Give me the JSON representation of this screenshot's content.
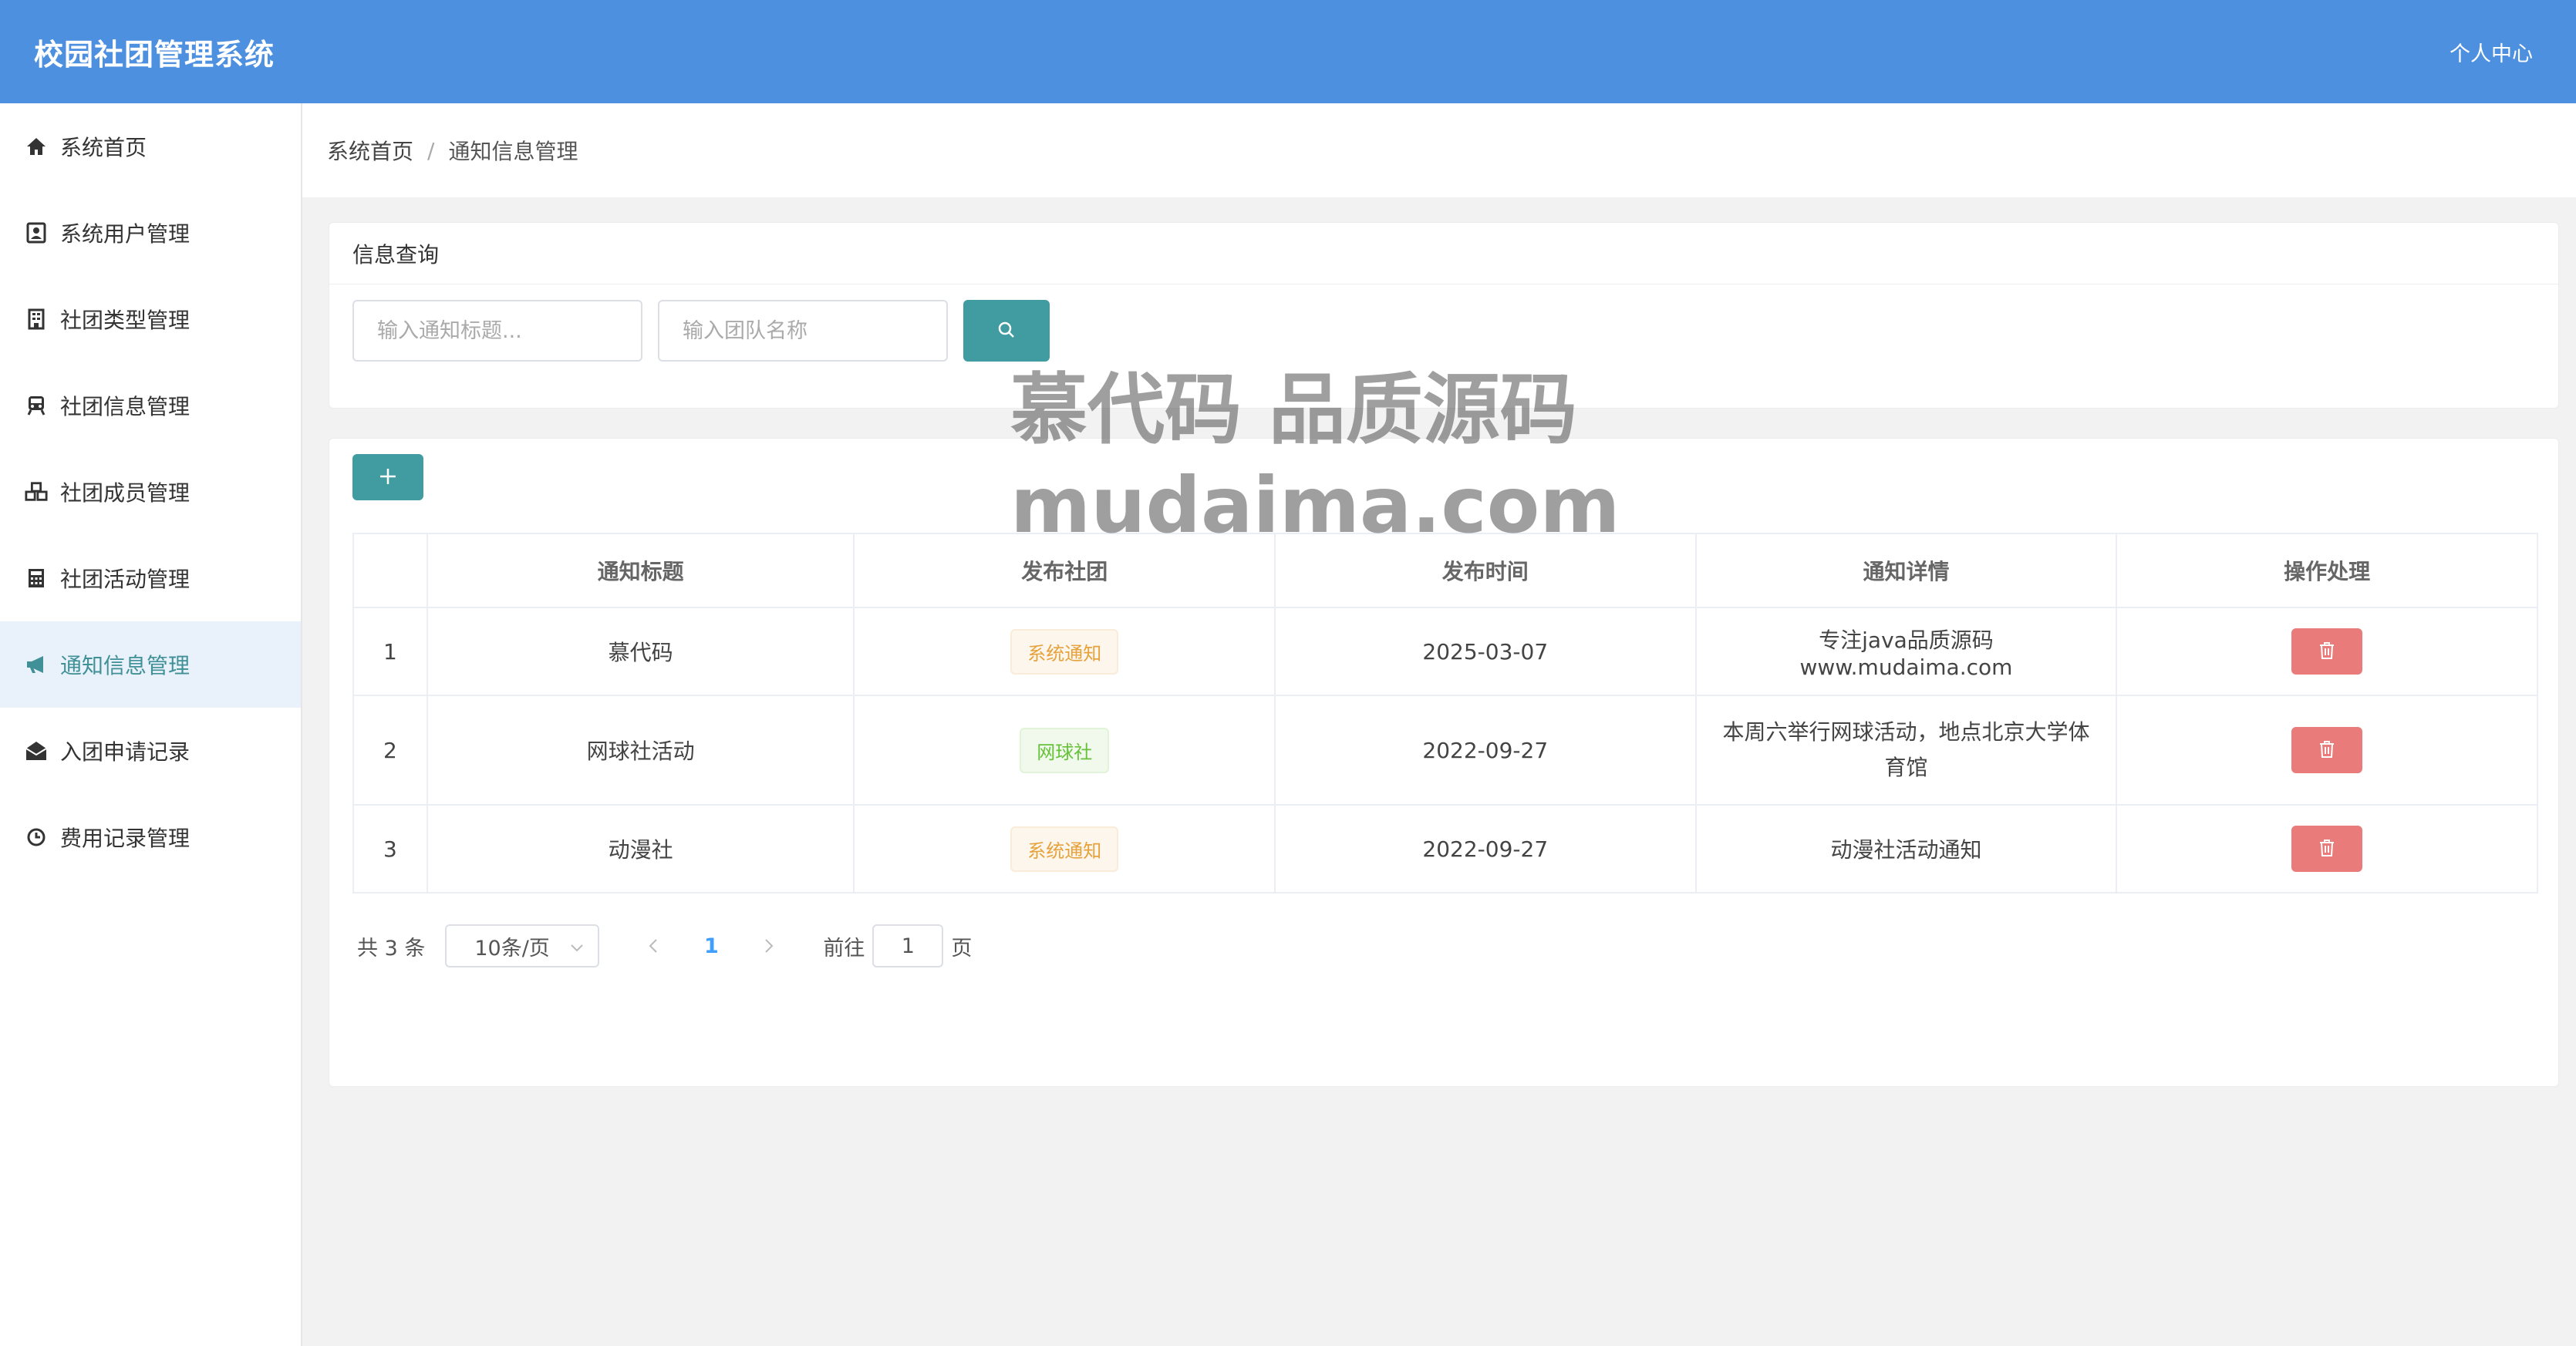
{
  "header": {
    "title": "校园社团管理系统",
    "user": "个人中心"
  },
  "sidebar": {
    "items": [
      {
        "label": "系统首页",
        "icon": "home-icon"
      },
      {
        "label": "系统用户管理",
        "icon": "user-card-icon"
      },
      {
        "label": "社团类型管理",
        "icon": "building-icon"
      },
      {
        "label": "社团信息管理",
        "icon": "train-icon"
      },
      {
        "label": "社团成员管理",
        "icon": "cubes-icon"
      },
      {
        "label": "社团活动管理",
        "icon": "calculator-icon"
      },
      {
        "label": "通知信息管理",
        "icon": "megaphone-icon"
      },
      {
        "label": "入团申请记录",
        "icon": "envelope-open-icon"
      },
      {
        "label": "费用记录管理",
        "icon": "clock-icon"
      }
    ],
    "active_index": 6,
    "active_color": "#409097"
  },
  "breadcrumb": {
    "home": "系统首页",
    "current": "通知信息管理"
  },
  "query": {
    "title": "信息查询",
    "title_placeholder": "输入通知标题...",
    "team_placeholder": "输入团队名称"
  },
  "table": {
    "headers": [
      "通知标题",
      "发布社团",
      "发布时间",
      "通知详情",
      "操作处理"
    ],
    "rows": [
      {
        "index": "1",
        "title": "慕代码",
        "club": "系统通知",
        "club_type": "warn",
        "time": "2025-03-07",
        "detail": "专注java品质源码 www.mudaima.com"
      },
      {
        "index": "2",
        "title": "网球社活动",
        "club": "网球社",
        "club_type": "ok",
        "time": "2022-09-27",
        "detail": "本周六举行网球活动，地点北京大学体育馆"
      },
      {
        "index": "3",
        "title": "动漫社",
        "club": "系统通知",
        "club_type": "warn",
        "time": "2022-09-27",
        "detail": "动漫社活动通知"
      }
    ]
  },
  "pager": {
    "total": "共 3 条",
    "page_size": "10条/页",
    "current": "1",
    "goto_prefix": "前往",
    "goto_value": "1",
    "goto_suffix": "页"
  },
  "watermark": {
    "line1": "慕代码 品质源码",
    "line2": "mudaima.com"
  },
  "colors": {
    "header": "#4e90e0",
    "primary_btn": "#409ca1",
    "danger_btn": "#e97b7b"
  }
}
